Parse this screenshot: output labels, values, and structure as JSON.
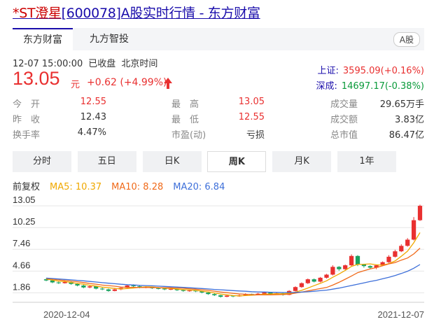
{
  "page": {
    "title_prefix": "*ST澄星",
    "title_rest": "[600078]A股实时行情 - 东方财富"
  },
  "tabs": {
    "items": [
      "东方财富",
      "九方智投"
    ],
    "market_badge": "A股"
  },
  "status": {
    "datetime": "12-07 15:00:00",
    "state": "已收盘",
    "timezone": "北京时间"
  },
  "quote": {
    "price": "13.05",
    "unit": "元",
    "change": "+0.62 (+4.99%)"
  },
  "indices": [
    {
      "name": "上证:",
      "value": "3595.09(+0.16%)"
    },
    {
      "name": "深成:",
      "value": "14697.17(-0.38%)"
    }
  ],
  "stats": {
    "col1": [
      {
        "label": "今　开",
        "value": "12.55",
        "color": "red"
      },
      {
        "label": "昨　收",
        "value": "12.43",
        "color": ""
      },
      {
        "label": "换手率",
        "value": "4.47%",
        "color": ""
      }
    ],
    "col2": [
      {
        "label": "最　高",
        "value": "13.05",
        "color": "red"
      },
      {
        "label": "最　低",
        "value": "12.55",
        "color": "red"
      },
      {
        "label": "市盈(动)",
        "value": "亏损",
        "color": ""
      }
    ],
    "col3": [
      {
        "label": "成交量",
        "value": "29.65万手",
        "color": ""
      },
      {
        "label": "成交额",
        "value": "3.83亿",
        "color": ""
      },
      {
        "label": "总市值",
        "value": "86.47亿",
        "color": ""
      }
    ]
  },
  "periods": [
    "分时",
    "五日",
    "日K",
    "周K",
    "月K",
    "1年"
  ],
  "active_period": "周K",
  "colors": {
    "up": "#e93030",
    "down": "#1aa260",
    "ma5": "#f0a800",
    "ma10": "#f06a1a",
    "ma20": "#3d6fd9",
    "link": "#1a0dab"
  },
  "ma_legend": {
    "adjust": "前复权",
    "ma5": "MA5: 10.37",
    "ma10": "MA10: 8.28",
    "ma20": "MA20: 6.84"
  },
  "chart_data": {
    "type": "candlestick",
    "y_ticks": [
      "13.05",
      "10.25",
      "7.46",
      "4.66",
      "1.86"
    ],
    "y_tick_values": [
      13.05,
      10.25,
      7.46,
      4.66,
      1.86
    ],
    "ylim": [
      1.0,
      13.6
    ],
    "x_start_label": "2020-12-04",
    "x_end_label": "2021-12-07",
    "grid": true,
    "candles": [
      {
        "o": 3.6,
        "c": 3.45,
        "h": 3.7,
        "l": 3.35
      },
      {
        "o": 3.45,
        "c": 3.2,
        "h": 3.5,
        "l": 3.1
      },
      {
        "o": 3.2,
        "c": 3.1,
        "h": 3.3,
        "l": 3.0
      },
      {
        "o": 3.1,
        "c": 3.25,
        "h": 3.4,
        "l": 3.05
      },
      {
        "o": 3.25,
        "c": 3.0,
        "h": 3.3,
        "l": 2.9
      },
      {
        "o": 3.0,
        "c": 2.8,
        "h": 3.05,
        "l": 2.7
      },
      {
        "o": 2.8,
        "c": 2.55,
        "h": 2.9,
        "l": 2.45
      },
      {
        "o": 2.55,
        "c": 2.7,
        "h": 2.8,
        "l": 2.45
      },
      {
        "o": 2.7,
        "c": 2.4,
        "h": 2.75,
        "l": 2.3
      },
      {
        "o": 2.4,
        "c": 2.3,
        "h": 2.55,
        "l": 2.2
      },
      {
        "o": 2.3,
        "c": 2.1,
        "h": 2.4,
        "l": 2.0
      },
      {
        "o": 2.1,
        "c": 2.3,
        "h": 2.5,
        "l": 2.05
      },
      {
        "o": 2.3,
        "c": 2.5,
        "h": 2.6,
        "l": 2.2
      },
      {
        "o": 2.5,
        "c": 2.8,
        "h": 2.9,
        "l": 2.45
      },
      {
        "o": 2.8,
        "c": 2.7,
        "h": 2.95,
        "l": 2.6
      },
      {
        "o": 2.7,
        "c": 2.55,
        "h": 2.8,
        "l": 2.45
      },
      {
        "o": 2.55,
        "c": 2.6,
        "h": 2.7,
        "l": 2.45
      },
      {
        "o": 2.6,
        "c": 2.45,
        "h": 2.65,
        "l": 2.35
      },
      {
        "o": 2.45,
        "c": 2.4,
        "h": 2.55,
        "l": 2.3
      },
      {
        "o": 2.4,
        "c": 2.3,
        "h": 2.5,
        "l": 2.2
      },
      {
        "o": 2.3,
        "c": 2.35,
        "h": 2.45,
        "l": 2.2
      },
      {
        "o": 2.35,
        "c": 2.2,
        "h": 2.4,
        "l": 2.1
      },
      {
        "o": 2.2,
        "c": 2.1,
        "h": 2.3,
        "l": 2.0
      },
      {
        "o": 2.1,
        "c": 2.15,
        "h": 2.25,
        "l": 2.0
      },
      {
        "o": 2.15,
        "c": 2.05,
        "h": 2.2,
        "l": 1.95
      },
      {
        "o": 2.05,
        "c": 1.9,
        "h": 2.1,
        "l": 1.8
      },
      {
        "o": 1.9,
        "c": 1.7,
        "h": 1.95,
        "l": 1.6
      },
      {
        "o": 1.7,
        "c": 1.55,
        "h": 1.8,
        "l": 1.45
      },
      {
        "o": 1.55,
        "c": 1.35,
        "h": 1.6,
        "l": 1.25
      },
      {
        "o": 1.35,
        "c": 1.5,
        "h": 1.6,
        "l": 1.3
      },
      {
        "o": 1.5,
        "c": 1.4,
        "h": 1.55,
        "l": 1.3
      },
      {
        "o": 1.4,
        "c": 1.55,
        "h": 1.65,
        "l": 1.35
      },
      {
        "o": 1.55,
        "c": 1.7,
        "h": 1.8,
        "l": 1.5
      },
      {
        "o": 1.7,
        "c": 1.6,
        "h": 1.75,
        "l": 1.5
      },
      {
        "o": 1.6,
        "c": 1.75,
        "h": 1.85,
        "l": 1.55
      },
      {
        "o": 1.75,
        "c": 1.9,
        "h": 2.0,
        "l": 1.7
      },
      {
        "o": 1.9,
        "c": 1.65,
        "h": 1.95,
        "l": 1.55
      },
      {
        "o": 1.65,
        "c": 1.8,
        "h": 1.9,
        "l": 1.6
      },
      {
        "o": 1.8,
        "c": 1.6,
        "h": 1.85,
        "l": 1.5
      },
      {
        "o": 1.6,
        "c": 2.1,
        "h": 2.2,
        "l": 1.55
      },
      {
        "o": 2.1,
        "c": 2.6,
        "h": 2.7,
        "l": 2.05
      },
      {
        "o": 2.6,
        "c": 3.1,
        "h": 3.2,
        "l": 2.5
      },
      {
        "o": 3.1,
        "c": 3.6,
        "h": 3.7,
        "l": 3.0
      },
      {
        "o": 3.6,
        "c": 3.3,
        "h": 3.7,
        "l": 3.2
      },
      {
        "o": 3.3,
        "c": 3.8,
        "h": 3.9,
        "l": 3.2
      },
      {
        "o": 3.8,
        "c": 4.2,
        "h": 4.3,
        "l": 3.7
      },
      {
        "o": 4.2,
        "c": 5.2,
        "h": 5.4,
        "l": 4.1
      },
      {
        "o": 5.2,
        "c": 4.9,
        "h": 5.3,
        "l": 4.7
      },
      {
        "o": 4.9,
        "c": 5.4,
        "h": 5.5,
        "l": 4.8
      },
      {
        "o": 5.4,
        "c": 6.6,
        "h": 6.8,
        "l": 5.3
      },
      {
        "o": 6.6,
        "c": 5.5,
        "h": 6.7,
        "l": 5.3
      },
      {
        "o": 5.5,
        "c": 5.3,
        "h": 5.6,
        "l": 5.1
      },
      {
        "o": 5.3,
        "c": 5.1,
        "h": 5.4,
        "l": 4.9
      },
      {
        "o": 5.1,
        "c": 5.4,
        "h": 5.5,
        "l": 4.9
      },
      {
        "o": 5.4,
        "c": 5.8,
        "h": 5.9,
        "l": 5.3
      },
      {
        "o": 5.8,
        "c": 6.5,
        "h": 6.7,
        "l": 5.7
      },
      {
        "o": 6.5,
        "c": 7.2,
        "h": 7.4,
        "l": 6.4
      },
      {
        "o": 7.2,
        "c": 7.9,
        "h": 8.1,
        "l": 7.1
      },
      {
        "o": 7.9,
        "c": 8.7,
        "h": 8.9,
        "l": 7.8
      },
      {
        "o": 8.7,
        "c": 11.2,
        "h": 11.6,
        "l": 8.6
      },
      {
        "o": 11.2,
        "c": 13.05,
        "h": 13.2,
        "l": 11.1
      }
    ],
    "ma5": [
      3.65,
      3.5,
      3.35,
      3.3,
      3.2,
      3.07,
      2.96,
      2.83,
      2.73,
      2.59,
      2.51,
      2.42,
      2.36,
      2.4,
      2.48,
      2.57,
      2.63,
      2.62,
      2.54,
      2.46,
      2.42,
      2.34,
      2.28,
      2.22,
      2.17,
      2.08,
      1.98,
      1.85,
      1.71,
      1.6,
      1.5,
      1.47,
      1.5,
      1.55,
      1.6,
      1.7,
      1.72,
      1.74,
      1.73,
      1.79,
      1.95,
      2.18,
      2.48,
      2.78,
      3.08,
      3.4,
      3.86,
      4.28,
      4.74,
      5.26,
      5.52,
      5.54,
      5.58,
      5.46,
      5.42,
      5.62,
      5.96,
      6.56,
      7.22,
      8.3,
      9.6
    ],
    "ma10": [
      3.7,
      3.62,
      3.52,
      3.44,
      3.38,
      3.29,
      3.18,
      3.06,
      2.97,
      2.85,
      2.79,
      2.71,
      2.61,
      2.57,
      2.56,
      2.54,
      2.56,
      2.55,
      2.52,
      2.51,
      2.5,
      2.48,
      2.45,
      2.38,
      2.32,
      2.25,
      2.18,
      2.07,
      1.96,
      1.88,
      1.79,
      1.72,
      1.67,
      1.63,
      1.6,
      1.6,
      1.6,
      1.62,
      1.64,
      1.69,
      1.82,
      1.95,
      2.11,
      2.26,
      2.4,
      2.55,
      2.85,
      3.21,
      3.61,
      4.02,
      4.46,
      4.7,
      4.93,
      5.1,
      5.34,
      5.58,
      5.75,
      6.07,
      6.34,
      6.86,
      7.61
    ],
    "ma20": [
      3.75,
      3.7,
      3.64,
      3.58,
      3.53,
      3.47,
      3.4,
      3.32,
      3.25,
      3.17,
      3.1,
      3.03,
      2.96,
      2.91,
      2.87,
      2.82,
      2.79,
      2.76,
      2.72,
      2.68,
      2.64,
      2.6,
      2.56,
      2.51,
      2.46,
      2.41,
      2.36,
      2.3,
      2.25,
      2.2,
      2.14,
      2.1,
      2.06,
      2.01,
      1.98,
      1.96,
      1.94,
      1.92,
      1.9,
      1.9,
      1.92,
      1.95,
      2.0,
      2.06,
      2.13,
      2.21,
      2.33,
      2.47,
      2.63,
      2.8,
      2.97,
      3.14,
      3.31,
      3.47,
      3.66,
      3.86,
      4.09,
      4.35,
      4.64,
      5.02,
      5.5
    ]
  }
}
